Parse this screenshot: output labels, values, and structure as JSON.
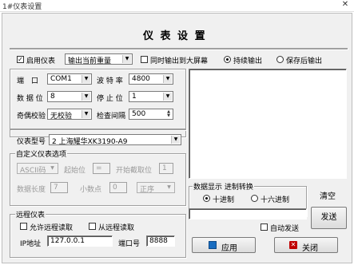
{
  "window": {
    "title": "1#仪表设置",
    "close_glyph": "✕"
  },
  "header": {
    "title": "仪 表 设 置"
  },
  "top_row": {
    "enable_meter": {
      "label": "启用仪表",
      "checked": true
    },
    "output_combo": {
      "value": "输出当前重量"
    },
    "sync_big_screen": {
      "label": "同时输出到大屏幕",
      "checked": false
    },
    "continuous_output": {
      "label": "持续输出",
      "selected": true
    },
    "save_output": {
      "label": "保存后输出",
      "selected": false
    }
  },
  "serial": {
    "port_label": "端　口",
    "port_value": "COM1",
    "baud_label": "波 特 率",
    "baud_value": "4800",
    "databits_label": "数 据 位",
    "databits_value": "8",
    "stopbits_label": "停 止 位",
    "stopbits_value": "1",
    "parity_label": "奇偶校验",
    "parity_value": "无校验",
    "interval_label": "检查间隔",
    "interval_value": "500"
  },
  "meter_model": {
    "label": "仪表型号",
    "value": "2 上海耀华XK3190-A9"
  },
  "custom": {
    "group_label": "自定义仪表选项",
    "mode_value": "ASCII码",
    "start_label": "起始位",
    "start_value": "=",
    "intercept_label": "开始截取位",
    "intercept_value": "1",
    "datalen_label": "数据长度",
    "datalen_value": "7",
    "decimal_label": "小数点",
    "decimal_value": "0",
    "order_value": "正序"
  },
  "remote": {
    "group_label": "远程仪表",
    "allow_remote": {
      "label": "允许远程读取",
      "checked": false
    },
    "read_remote": {
      "label": "从远程读取",
      "checked": false
    },
    "ip_label": "IP地址",
    "ip_value": "127.0.0.1",
    "port_label": "端口号",
    "port_value": "8888"
  },
  "display": {
    "group_label": "数据显示 进制转换",
    "decimal": {
      "label": "十进制",
      "selected": true
    },
    "hex": {
      "label": "十六进制",
      "selected": false
    },
    "clear_label": "清空",
    "auto_send": {
      "label": "自动发送",
      "checked": false
    },
    "send_label": "发送",
    "send_input_value": ""
  },
  "footer": {
    "apply_label": "应用",
    "close_label": "关闭"
  },
  "colors": {
    "group_border": "#a0a0a0",
    "dialog_bg": "#f0f0f0",
    "accent_red": "#c00000",
    "accent_blue": "#1a6dc0"
  }
}
